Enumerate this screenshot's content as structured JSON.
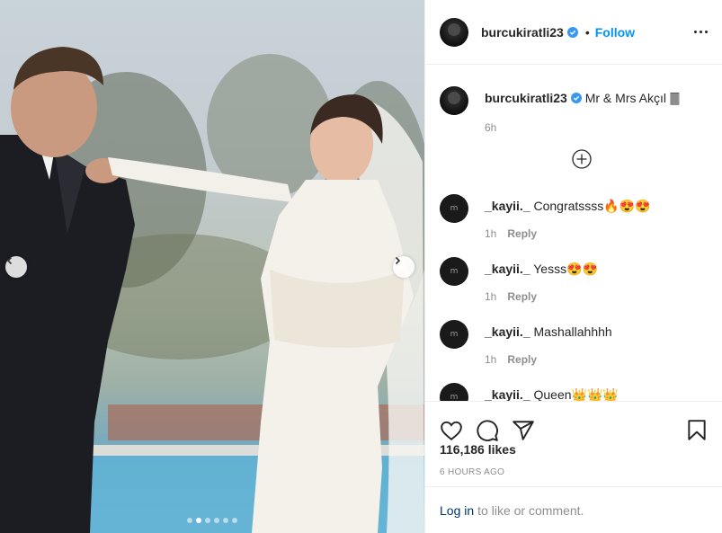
{
  "post": {
    "author": "burcukiratli23",
    "follow_label": "Follow",
    "bullet": "•",
    "caption": "Mr & Mrs Akçıl 🀫",
    "caption_time": "6h",
    "carousel_dots": 6,
    "active_dot": 1
  },
  "comments": [
    {
      "user": "_kayii._",
      "text": "Congratssss🔥😍😍",
      "time": "1h",
      "reply": "Reply"
    },
    {
      "user": "_kayii._",
      "text": "Yesss😍😍",
      "time": "1h",
      "reply": "Reply"
    },
    {
      "user": "_kayii._",
      "text": "Mashallahhhh",
      "time": "1h",
      "reply": "Reply"
    },
    {
      "user": "_kayii._",
      "text": "Queen👑👑👑",
      "time": "1h",
      "reply": "Reply"
    }
  ],
  "footer": {
    "likes": "116,186 likes",
    "posted": "6 HOURS AGO",
    "login_link": "Log in",
    "login_rest": "to like or comment."
  },
  "avatar_letter": "m",
  "colors": {
    "accent": "#0095f6",
    "link": "#00376b",
    "muted": "#8e8e8e",
    "text": "#262626"
  }
}
